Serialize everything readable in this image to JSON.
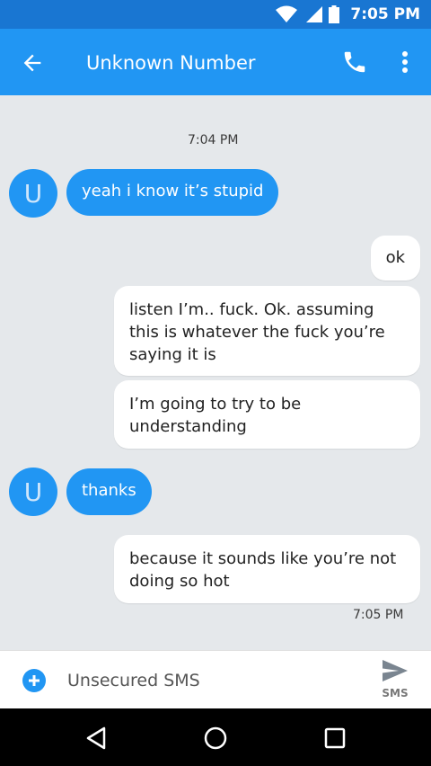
{
  "status_bar": {
    "time": "7:05 PM",
    "icons": [
      "wifi-icon",
      "signal-icon",
      "battery-icon"
    ]
  },
  "app_bar": {
    "title": "Unknown Number",
    "icons": [
      "back-arrow-icon",
      "phone-icon",
      "more-vert-icon"
    ]
  },
  "thread": {
    "top_timestamp": "7:04 PM",
    "avatar_letter": "U",
    "messages": [
      {
        "direction": "incoming",
        "text": "yeah i know it’s stupid"
      },
      {
        "direction": "outgoing",
        "text": "ok"
      },
      {
        "direction": "outgoing",
        "text": "listen I’m.. fuck. Ok. assuming this is whatever the fuck you’re saying it is"
      },
      {
        "direction": "outgoing",
        "text": "I’m going to try to be understanding"
      },
      {
        "direction": "incoming",
        "text": "thanks"
      },
      {
        "direction": "outgoing",
        "text": "because it sounds like you’re not doing so hot"
      }
    ],
    "bottom_timestamp": "7:05 PM"
  },
  "compose": {
    "placeholder": "Unsecured SMS",
    "send_label": "SMS"
  },
  "nav_bar": {
    "icons": [
      "back-triangle-icon",
      "home-circle-icon",
      "recents-square-icon"
    ]
  },
  "colors": {
    "primary": "#2196f3",
    "primary_dark": "#1976d2",
    "background": "#e5e8eb",
    "outgoing_bubble": "#ffffff"
  }
}
